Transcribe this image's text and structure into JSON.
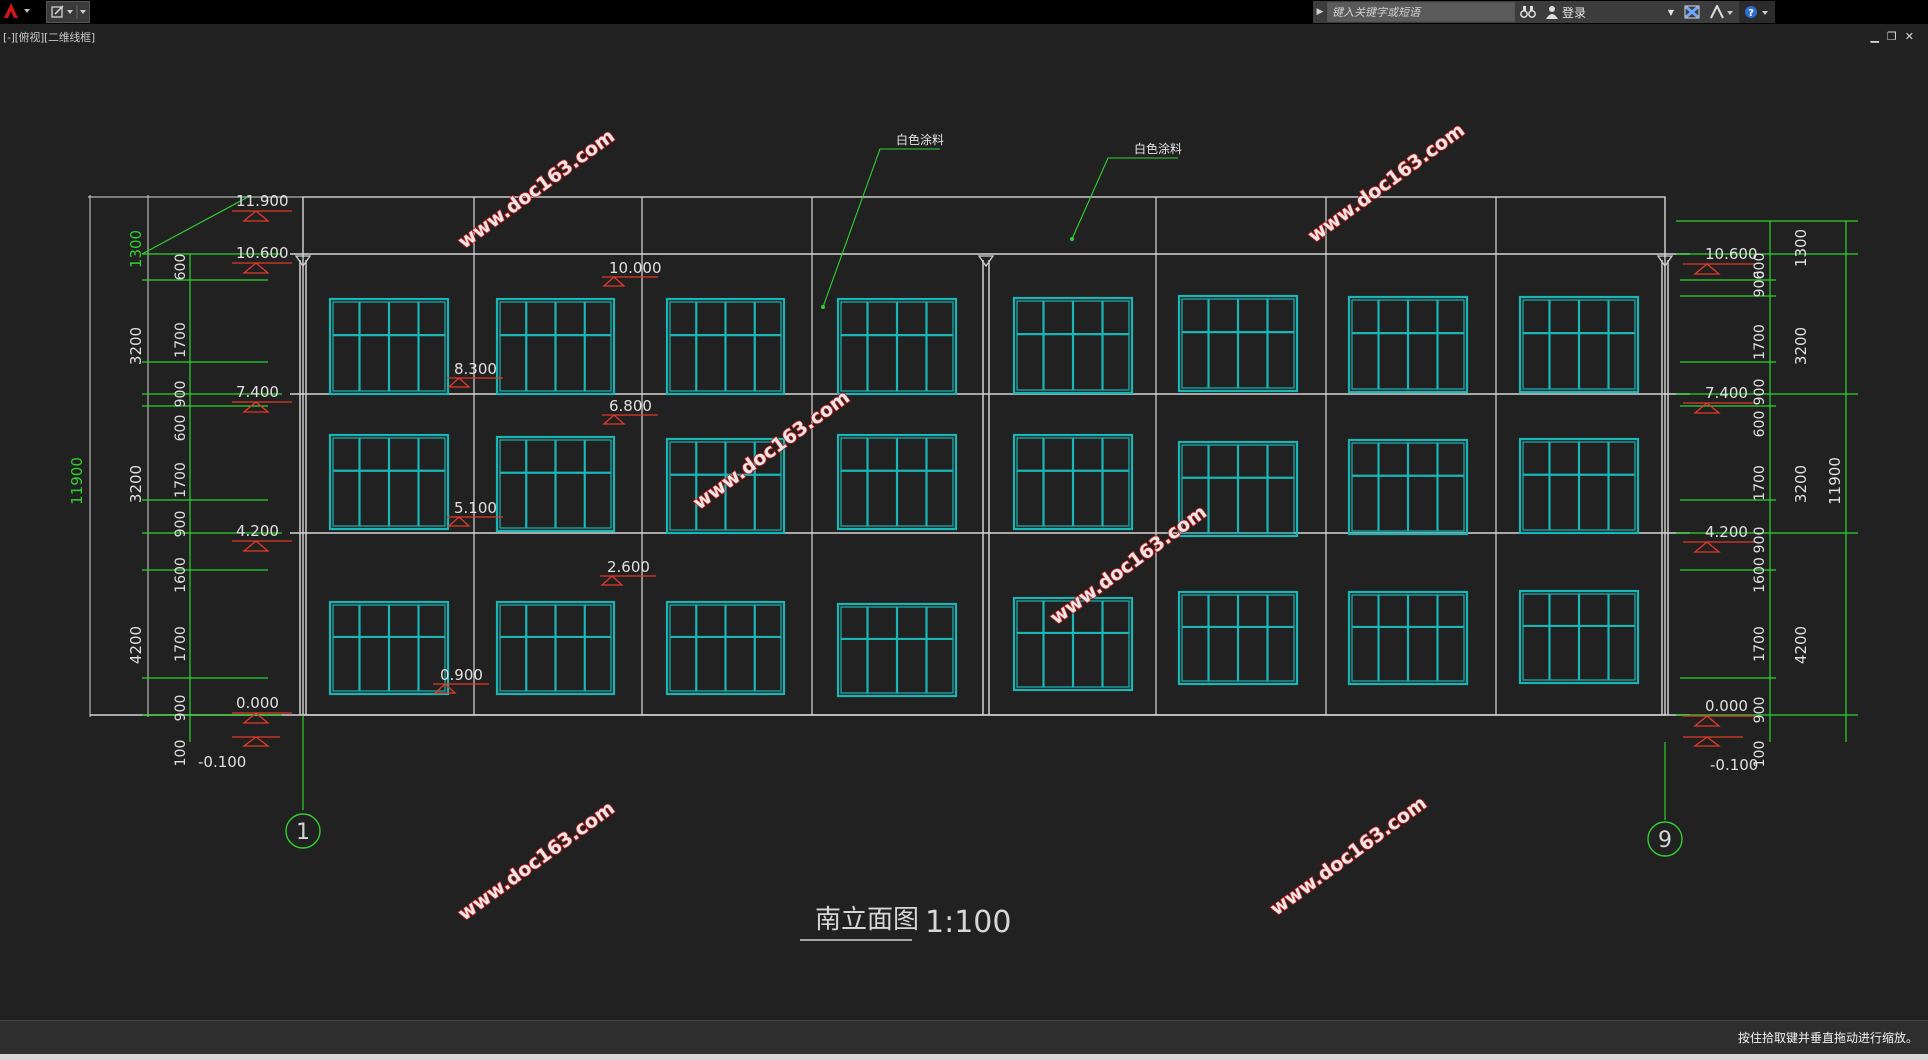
{
  "titlebar": {
    "search_placeholder": "键入关键字或短语",
    "login_label": "登录"
  },
  "viewport": {
    "label": "[-][俯视][二维线框]"
  },
  "status": {
    "message": "按住拾取键并垂直拖动进行缩放。"
  },
  "drawing": {
    "title": "南立面图",
    "scale": "1:100",
    "notes": [
      "白色涂料",
      "白色涂料"
    ],
    "watermark": "www.doc163.com",
    "axes": [
      "1",
      "9"
    ],
    "elevations_left": [
      "11.900",
      "10.600",
      "7.400",
      "4.200",
      "0.000",
      "-0.100"
    ],
    "elevations_right": [
      "10.600",
      "7.400",
      "4.200",
      "0.000",
      "-0.100"
    ],
    "elevations_inner": [
      "10.000",
      "8.300",
      "6.800",
      "5.100",
      "2.600",
      "0.900"
    ],
    "dims_left_inner": [
      "600",
      "1700",
      "900",
      "600",
      "1700",
      "900",
      "1600",
      "1700",
      "900",
      "100"
    ],
    "dims_left_outer": [
      "1300",
      "3200",
      "3200",
      "4200"
    ],
    "dims_left_total": "11900",
    "dims_right_inner": [
      "600",
      "900",
      "1700",
      "900",
      "600",
      "1700",
      "900",
      "1600",
      "1700",
      "900",
      "100"
    ],
    "dims_right_outer": [
      "1300",
      "3200",
      "3200",
      "4200"
    ],
    "dims_right_total": "11900"
  }
}
